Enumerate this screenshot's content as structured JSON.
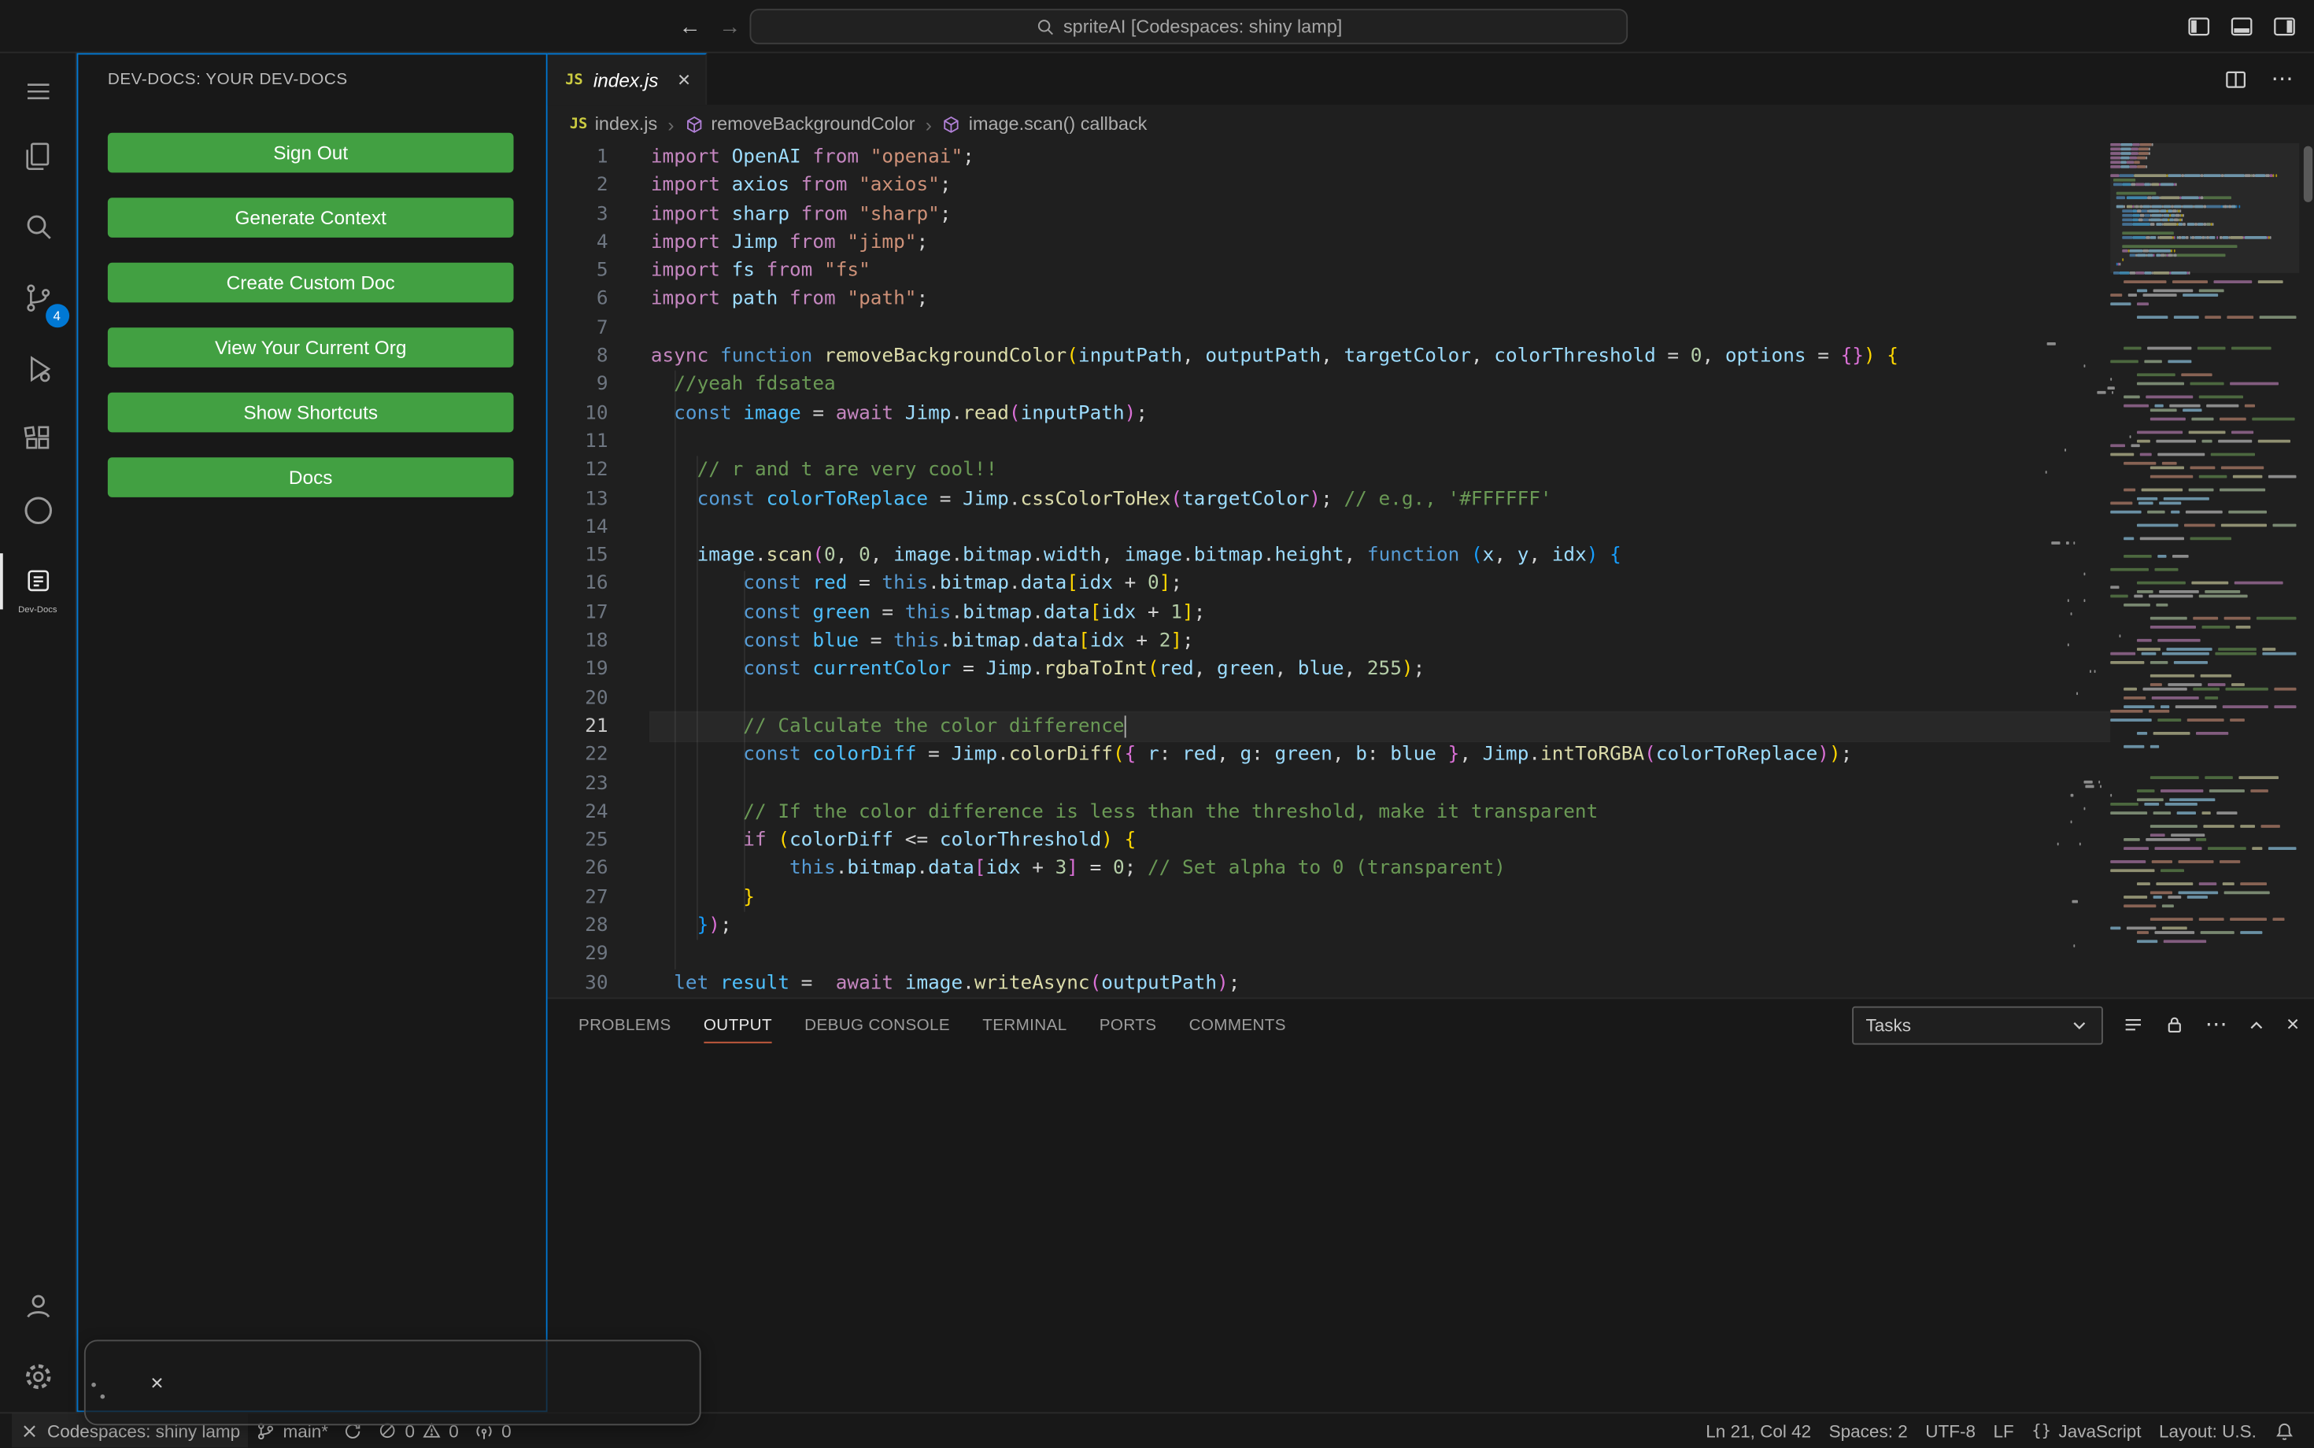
{
  "colors": {
    "ui": {
      "accent": "#0078d4",
      "button_green": "#42a042",
      "panel_underline": "#cb5d3f",
      "badge": "#0078d4",
      "js_yellow": "#cbcb41",
      "symbol_purple": "#b180d7"
    },
    "syntax": {
      "k": "#C586C0",
      "d": "#569CD6",
      "f": "#DCDCAA",
      "v": "#9CDCFE",
      "c": "#4FC1FF",
      "s": "#CE9178",
      "n": "#B5CEA8",
      "m": "#6A9955",
      "p": "#D4D4D4",
      "b1": "#FFD700",
      "b2": "#DA70D6",
      "b3": "#179FFF"
    }
  },
  "icons": {
    "js": "JS",
    "close": "×",
    "more": "⋯",
    "crumb_sep": "›",
    "back": "←",
    "forward": "→",
    "braces": "{}"
  },
  "titlebar": {
    "command_center_label": "spriteAI [Codespaces: shiny lamp]"
  },
  "activity_bar": {
    "source_control_badge": "4",
    "devdocs_label": "Dev-Docs"
  },
  "sidebar": {
    "title": "DEV-DOCS: YOUR DEV-DOCS",
    "buttons": [
      "Sign Out",
      "Generate Context",
      "Create Custom Doc",
      "View Your Current Org",
      "Show Shortcuts",
      "Docs"
    ]
  },
  "editor": {
    "tab_label": "index.js",
    "breadcrumbs": [
      {
        "label": "index.js",
        "icon": "js"
      },
      {
        "label": "removeBackgroundColor",
        "icon": "symbol"
      },
      {
        "label": "image.scan() callback",
        "icon": "symbol"
      }
    ],
    "active_line": 21,
    "cursor_col": 42,
    "lines": [
      [
        [
          "k",
          "import "
        ],
        [
          "v",
          "OpenAI "
        ],
        [
          "k",
          "from "
        ],
        [
          "s",
          "\"openai\""
        ],
        [
          "p",
          ";"
        ]
      ],
      [
        [
          "k",
          "import "
        ],
        [
          "v",
          "axios "
        ],
        [
          "k",
          "from "
        ],
        [
          "s",
          "\"axios\""
        ],
        [
          "p",
          ";"
        ]
      ],
      [
        [
          "k",
          "import "
        ],
        [
          "v",
          "sharp "
        ],
        [
          "k",
          "from "
        ],
        [
          "s",
          "\"sharp\""
        ],
        [
          "p",
          ";"
        ]
      ],
      [
        [
          "k",
          "import "
        ],
        [
          "v",
          "Jimp "
        ],
        [
          "k",
          "from "
        ],
        [
          "s",
          "\"jimp\""
        ],
        [
          "p",
          ";"
        ]
      ],
      [
        [
          "k",
          "import "
        ],
        [
          "v",
          "fs "
        ],
        [
          "k",
          "from "
        ],
        [
          "s",
          "\"fs\""
        ]
      ],
      [
        [
          "k",
          "import "
        ],
        [
          "v",
          "path "
        ],
        [
          "k",
          "from "
        ],
        [
          "s",
          "\"path\""
        ],
        [
          "p",
          ";"
        ]
      ],
      [],
      [
        [
          "k",
          "async "
        ],
        [
          "d",
          "function "
        ],
        [
          "f",
          "removeBackgroundColor"
        ],
        [
          "b1",
          "("
        ],
        [
          "v",
          "inputPath"
        ],
        [
          "p",
          ", "
        ],
        [
          "v",
          "outputPath"
        ],
        [
          "p",
          ", "
        ],
        [
          "v",
          "targetColor"
        ],
        [
          "p",
          ", "
        ],
        [
          "v",
          "colorThreshold"
        ],
        [
          "p",
          " = "
        ],
        [
          "n",
          "0"
        ],
        [
          "p",
          ", "
        ],
        [
          "v",
          "options"
        ],
        [
          "p",
          " = "
        ],
        [
          "b2",
          "{}"
        ],
        [
          "b1",
          ")"
        ],
        [
          "p",
          " "
        ],
        [
          "b1",
          "{"
        ]
      ],
      [
        [
          "p",
          "  "
        ],
        [
          "m",
          "//yeah fdsatea"
        ]
      ],
      [
        [
          "p",
          "  "
        ],
        [
          "d",
          "const "
        ],
        [
          "c",
          "image"
        ],
        [
          "p",
          " = "
        ],
        [
          "k",
          "await "
        ],
        [
          "v",
          "Jimp"
        ],
        [
          "p",
          "."
        ],
        [
          "f",
          "read"
        ],
        [
          "b2",
          "("
        ],
        [
          "v",
          "inputPath"
        ],
        [
          "b2",
          ")"
        ],
        [
          "p",
          ";"
        ]
      ],
      [],
      [
        [
          "p",
          "    "
        ],
        [
          "m",
          "// r and t are very cool!!"
        ]
      ],
      [
        [
          "p",
          "    "
        ],
        [
          "d",
          "const "
        ],
        [
          "c",
          "colorToReplace"
        ],
        [
          "p",
          " = "
        ],
        [
          "v",
          "Jimp"
        ],
        [
          "p",
          "."
        ],
        [
          "f",
          "cssColorToHex"
        ],
        [
          "b2",
          "("
        ],
        [
          "v",
          "targetColor"
        ],
        [
          "b2",
          ")"
        ],
        [
          "p",
          "; "
        ],
        [
          "m",
          "// e.g., '#FFFFFF'"
        ]
      ],
      [],
      [
        [
          "p",
          "    "
        ],
        [
          "v",
          "image"
        ],
        [
          "p",
          "."
        ],
        [
          "f",
          "scan"
        ],
        [
          "b2",
          "("
        ],
        [
          "n",
          "0"
        ],
        [
          "p",
          ", "
        ],
        [
          "n",
          "0"
        ],
        [
          "p",
          ", "
        ],
        [
          "v",
          "image"
        ],
        [
          "p",
          "."
        ],
        [
          "v",
          "bitmap"
        ],
        [
          "p",
          "."
        ],
        [
          "v",
          "width"
        ],
        [
          "p",
          ", "
        ],
        [
          "v",
          "image"
        ],
        [
          "p",
          "."
        ],
        [
          "v",
          "bitmap"
        ],
        [
          "p",
          "."
        ],
        [
          "v",
          "height"
        ],
        [
          "p",
          ", "
        ],
        [
          "d",
          "function "
        ],
        [
          "b3",
          "("
        ],
        [
          "v",
          "x"
        ],
        [
          "p",
          ", "
        ],
        [
          "v",
          "y"
        ],
        [
          "p",
          ", "
        ],
        [
          "v",
          "idx"
        ],
        [
          "b3",
          ")"
        ],
        [
          "p",
          " "
        ],
        [
          "b3",
          "{"
        ]
      ],
      [
        [
          "p",
          "        "
        ],
        [
          "d",
          "const "
        ],
        [
          "c",
          "red"
        ],
        [
          "p",
          " = "
        ],
        [
          "d",
          "this"
        ],
        [
          "p",
          "."
        ],
        [
          "v",
          "bitmap"
        ],
        [
          "p",
          "."
        ],
        [
          "v",
          "data"
        ],
        [
          "b1",
          "["
        ],
        [
          "v",
          "idx"
        ],
        [
          "p",
          " + "
        ],
        [
          "n",
          "0"
        ],
        [
          "b1",
          "]"
        ],
        [
          "p",
          ";"
        ]
      ],
      [
        [
          "p",
          "        "
        ],
        [
          "d",
          "const "
        ],
        [
          "c",
          "green"
        ],
        [
          "p",
          " = "
        ],
        [
          "d",
          "this"
        ],
        [
          "p",
          "."
        ],
        [
          "v",
          "bitmap"
        ],
        [
          "p",
          "."
        ],
        [
          "v",
          "data"
        ],
        [
          "b1",
          "["
        ],
        [
          "v",
          "idx"
        ],
        [
          "p",
          " + "
        ],
        [
          "n",
          "1"
        ],
        [
          "b1",
          "]"
        ],
        [
          "p",
          ";"
        ]
      ],
      [
        [
          "p",
          "        "
        ],
        [
          "d",
          "const "
        ],
        [
          "c",
          "blue"
        ],
        [
          "p",
          " = "
        ],
        [
          "d",
          "this"
        ],
        [
          "p",
          "."
        ],
        [
          "v",
          "bitmap"
        ],
        [
          "p",
          "."
        ],
        [
          "v",
          "data"
        ],
        [
          "b1",
          "["
        ],
        [
          "v",
          "idx"
        ],
        [
          "p",
          " + "
        ],
        [
          "n",
          "2"
        ],
        [
          "b1",
          "]"
        ],
        [
          "p",
          ";"
        ]
      ],
      [
        [
          "p",
          "        "
        ],
        [
          "d",
          "const "
        ],
        [
          "c",
          "currentColor"
        ],
        [
          "p",
          " = "
        ],
        [
          "v",
          "Jimp"
        ],
        [
          "p",
          "."
        ],
        [
          "f",
          "rgbaToInt"
        ],
        [
          "b1",
          "("
        ],
        [
          "v",
          "red"
        ],
        [
          "p",
          ", "
        ],
        [
          "v",
          "green"
        ],
        [
          "p",
          ", "
        ],
        [
          "v",
          "blue"
        ],
        [
          "p",
          ", "
        ],
        [
          "n",
          "255"
        ],
        [
          "b1",
          ")"
        ],
        [
          "p",
          ";"
        ]
      ],
      [],
      [
        [
          "p",
          "        "
        ],
        [
          "m",
          "// Calculate the color difference"
        ]
      ],
      [
        [
          "p",
          "        "
        ],
        [
          "d",
          "const "
        ],
        [
          "c",
          "colorDiff"
        ],
        [
          "p",
          " = "
        ],
        [
          "v",
          "Jimp"
        ],
        [
          "p",
          "."
        ],
        [
          "f",
          "colorDiff"
        ],
        [
          "b1",
          "("
        ],
        [
          "b2",
          "{"
        ],
        [
          "p",
          " "
        ],
        [
          "v",
          "r"
        ],
        [
          "p",
          ": "
        ],
        [
          "v",
          "red"
        ],
        [
          "p",
          ", "
        ],
        [
          "v",
          "g"
        ],
        [
          "p",
          ": "
        ],
        [
          "v",
          "green"
        ],
        [
          "p",
          ", "
        ],
        [
          "v",
          "b"
        ],
        [
          "p",
          ": "
        ],
        [
          "v",
          "blue"
        ],
        [
          "p",
          " "
        ],
        [
          "b2",
          "}"
        ],
        [
          "p",
          ", "
        ],
        [
          "v",
          "Jimp"
        ],
        [
          "p",
          "."
        ],
        [
          "f",
          "intToRGBA"
        ],
        [
          "b2",
          "("
        ],
        [
          "v",
          "colorToReplace"
        ],
        [
          "b2",
          ")"
        ],
        [
          "b1",
          ")"
        ],
        [
          "p",
          ";"
        ]
      ],
      [],
      [
        [
          "p",
          "        "
        ],
        [
          "m",
          "// If the color difference is less than the threshold, make it transparent"
        ]
      ],
      [
        [
          "p",
          "        "
        ],
        [
          "k",
          "if "
        ],
        [
          "b1",
          "("
        ],
        [
          "v",
          "colorDiff"
        ],
        [
          "p",
          " <= "
        ],
        [
          "v",
          "colorThreshold"
        ],
        [
          "b1",
          ")"
        ],
        [
          "p",
          " "
        ],
        [
          "b1",
          "{"
        ]
      ],
      [
        [
          "p",
          "            "
        ],
        [
          "d",
          "this"
        ],
        [
          "p",
          "."
        ],
        [
          "v",
          "bitmap"
        ],
        [
          "p",
          "."
        ],
        [
          "v",
          "data"
        ],
        [
          "b2",
          "["
        ],
        [
          "v",
          "idx"
        ],
        [
          "p",
          " + "
        ],
        [
          "n",
          "3"
        ],
        [
          "b2",
          "]"
        ],
        [
          "p",
          " = "
        ],
        [
          "n",
          "0"
        ],
        [
          "p",
          "; "
        ],
        [
          "m",
          "// Set alpha to 0 (transparent)"
        ]
      ],
      [
        [
          "p",
          "        "
        ],
        [
          "b1",
          "}"
        ]
      ],
      [
        [
          "p",
          "    "
        ],
        [
          "b3",
          "}"
        ],
        [
          "b2",
          ")"
        ],
        [
          "p",
          ";"
        ]
      ],
      [],
      [
        [
          "p",
          "  "
        ],
        [
          "d",
          "let "
        ],
        [
          "c",
          "result"
        ],
        [
          "p",
          " =  "
        ],
        [
          "k",
          "await "
        ],
        [
          "v",
          "image"
        ],
        [
          "p",
          "."
        ],
        [
          "f",
          "writeAsync"
        ],
        [
          "b2",
          "("
        ],
        [
          "v",
          "outputPath"
        ],
        [
          "b2",
          ")"
        ],
        [
          "p",
          ";"
        ]
      ]
    ]
  },
  "panel": {
    "tabs": [
      {
        "label": "PROBLEMS",
        "active": false
      },
      {
        "label": "OUTPUT",
        "active": true
      },
      {
        "label": "DEBUG CONSOLE",
        "active": false
      },
      {
        "label": "TERMINAL",
        "active": false
      },
      {
        "label": "PORTS",
        "active": false
      },
      {
        "label": "COMMENTS",
        "active": false
      }
    ],
    "tasks_dropdown": "Tasks"
  },
  "status_bar": {
    "remote": "Codespaces: shiny lamp",
    "branch": "main*",
    "errors": "0",
    "warnings": "0",
    "ports": "0",
    "cursor": "Ln 21, Col 42",
    "indent": "Spaces: 2",
    "encoding": "UTF-8",
    "eol": "LF",
    "language": "JavaScript",
    "layout": "Layout: U.S."
  }
}
